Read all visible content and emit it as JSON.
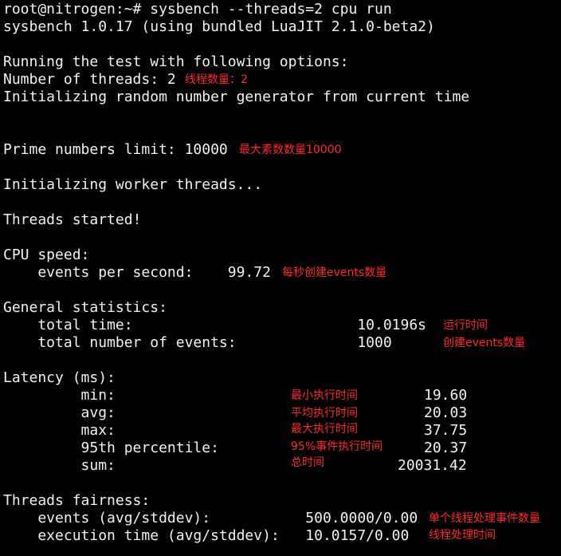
{
  "terminal": {
    "prompt": "root@nitrogen:~#",
    "command": "sysbench --threads=2 cpu run",
    "lines": [
      "sysbench 1.0.17 (using bundled LuaJIT 2.1.0-beta2)",
      "Running the test with following options:",
      "Number of threads: 2",
      "Initializing random number generator from current time",
      "Prime numbers limit: 10000",
      "Initializing worker threads...",
      "Threads started!",
      "CPU speed:",
      "    events per second:    99.72",
      "General statistics:",
      "    total time:                          10.0196s",
      "    total number of events:              1000",
      "Latency (ms):",
      "         min:",
      "         avg:",
      "         max:",
      "         95th percentile:",
      "         sum:",
      "Threads fairness:",
      "    events (avg/stddev):           500.0000/0.00",
      "    execution time (avg/stddev):   10.0157/0.00"
    ],
    "latency_values": {
      "min": "19.60",
      "avg": "20.03",
      "max": "37.75",
      "p95": "20.37",
      "sum": "20031.42"
    }
  },
  "annotations": {
    "threads": "线程数量：2",
    "prime_limit": "最大素数数量10000",
    "events_per_second": "每秒创建events数量",
    "total_time": "运行时间",
    "total_events": "创建events数量",
    "min": "最小执行时间",
    "avg": "平均执行时间",
    "max": "最大执行时间",
    "p95": "95%事件执行时间",
    "sum": "总时间",
    "events_fairness": "单个线程处理事件数量",
    "exec_time_fairness": "线程处理时间"
  },
  "colors": {
    "background": "#000000",
    "text": "#f2f2f2",
    "annotation": "#ff2a2a"
  }
}
